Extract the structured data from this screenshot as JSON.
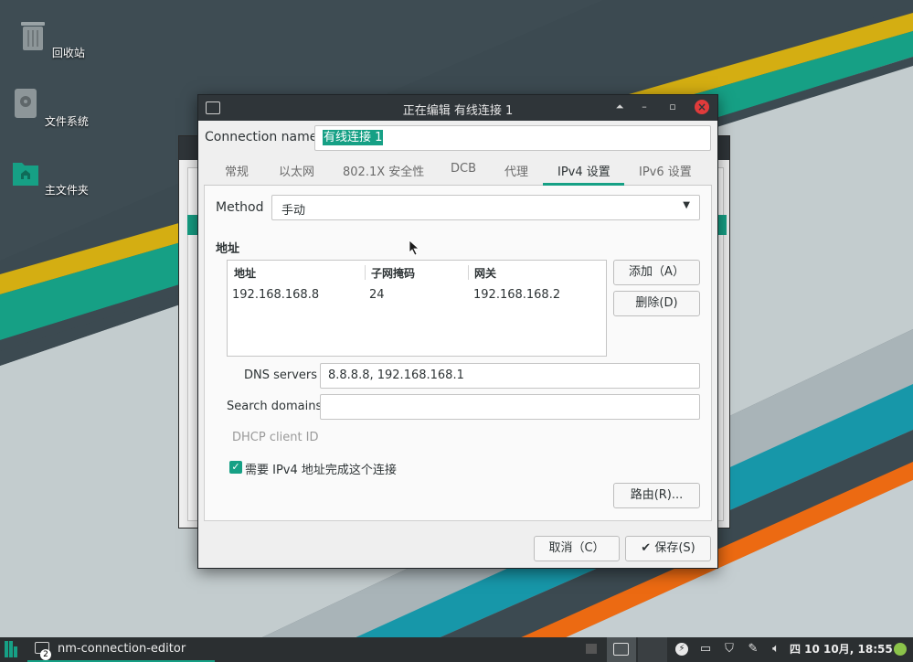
{
  "desktop": {
    "icons": [
      {
        "label": "回收站"
      },
      {
        "label": "文件系统"
      },
      {
        "label": "主文件夹"
      }
    ]
  },
  "dialog": {
    "title": "正在编辑 有线连接 1",
    "connection_name_label": "Connection name",
    "connection_name_value": "有线连接 1",
    "tabs": [
      {
        "label": "常规"
      },
      {
        "label": "以太网"
      },
      {
        "label": "802.1X 安全性"
      },
      {
        "label": "DCB"
      },
      {
        "label": "代理"
      },
      {
        "label": "IPv4 设置",
        "active": true
      },
      {
        "label": "IPv6 设置"
      }
    ],
    "method_label": "Method",
    "method_value": "手动",
    "addresses_heading": "地址",
    "table": {
      "headers": [
        "地址",
        "子网掩码",
        "网关"
      ],
      "rows": [
        [
          "192.168.168.8",
          "24",
          "192.168.168.2"
        ]
      ]
    },
    "add_button": "添加（A）",
    "delete_button": "删除(D)",
    "dns_label": "DNS servers",
    "dns_value": "8.8.8.8, 192.168.168.1",
    "search_domains_label": "Search domains",
    "search_domains_value": "",
    "dhcp_client_id_label": "DHCP client ID",
    "require_ipv4_label": "需要 IPv4 地址完成这个连接",
    "require_ipv4_checked": true,
    "routes_button": "路由(R)...",
    "cancel_button": "取消（C）",
    "save_button": "保存(S)"
  },
  "taskbar": {
    "task_label": "nm-connection-editor",
    "task_badge": "2",
    "clock": "四 10 10月, 18:55"
  },
  "colors": {
    "accent": "#16a085",
    "titlebar": "#2f3539",
    "close": "#e03b3b",
    "taskbar": "#2b2f31"
  }
}
